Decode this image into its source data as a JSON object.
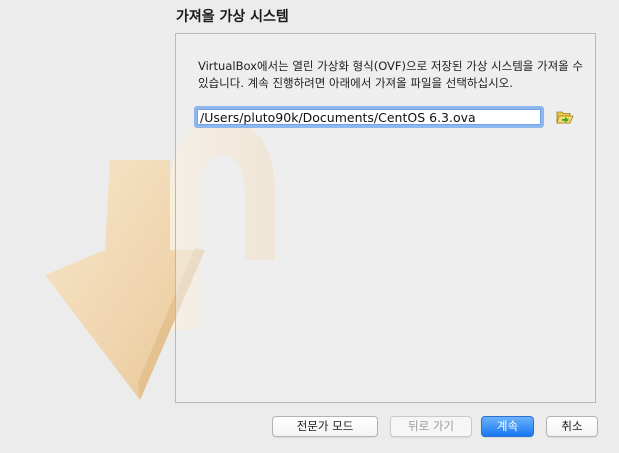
{
  "wizard": {
    "title": "가져올 가상 시스템",
    "description": "VirtualBox에서는 열린 가상화 형식(OVF)으로 저장된 가상 시스템을 가져올 수 있습니다. 계속 진행하려면 아래에서 가져올 파일을 선택하십시오.",
    "file_path": "/Users/pluto90k/Documents/CentOS 6.3.ova",
    "browse_icon": "folder-open-icon"
  },
  "buttons": {
    "expert_mode": "전문가 모드",
    "back": "뒤로 가기",
    "next": "계속",
    "cancel": "취소"
  },
  "colors": {
    "primary_button": "#1877f2",
    "focus_ring": "#8fb7ee",
    "window_bg": "#ececec"
  }
}
